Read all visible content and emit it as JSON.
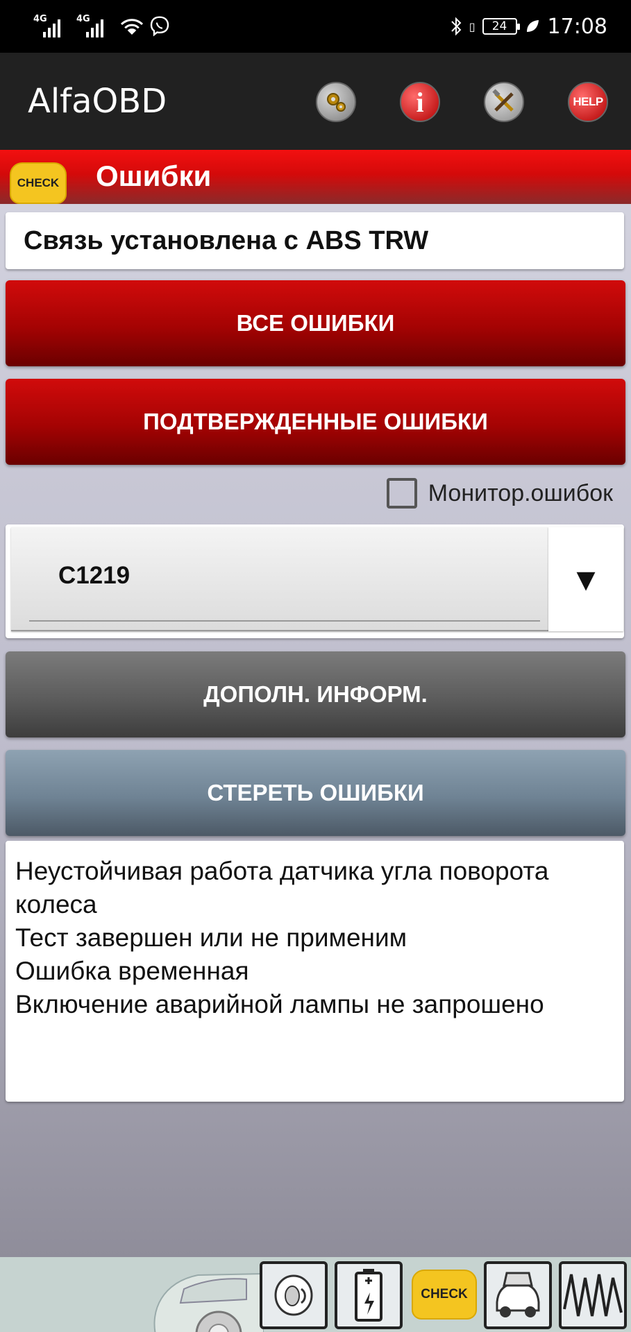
{
  "status_bar": {
    "signal1_label": "4G",
    "signal2_label": "4G",
    "battery_level": "24",
    "time": "17:08"
  },
  "app_bar": {
    "title": "AlfaOBD",
    "help_label": "HELP",
    "info_label": "i"
  },
  "header": {
    "check_label": "CHECK",
    "title": "Ошибки"
  },
  "status_box": {
    "text": "Связь установлена с ABS TRW"
  },
  "buttons": {
    "all_errors": "ВСЕ ОШИБКИ",
    "confirmed_errors": "ПОДТВЕРЖДЕННЫЕ ОШИБКИ",
    "more_info": "ДОПОЛН. ИНФОРМ.",
    "clear_errors": "СТЕРЕТЬ ОШИБКИ"
  },
  "monitor": {
    "label": "Монитор.ошибок",
    "checked": false
  },
  "dtc_spinner": {
    "selected": "C1219",
    "arrow": "▼"
  },
  "details": {
    "lines": [
      "Неустойчивая работа датчика угла поворота колеса",
      "Тест завершен или не применим",
      "Ошибка временная",
      "Включение аварийной лампы не запрошено"
    ]
  },
  "bottom_bar": {
    "check_label": "CHECK"
  },
  "colors": {
    "header_red": "#f21010",
    "button_red": "#b00606",
    "button_gray": "#5c5c5c",
    "button_steel": "#6f8394",
    "check_yellow": "#f4c520"
  }
}
